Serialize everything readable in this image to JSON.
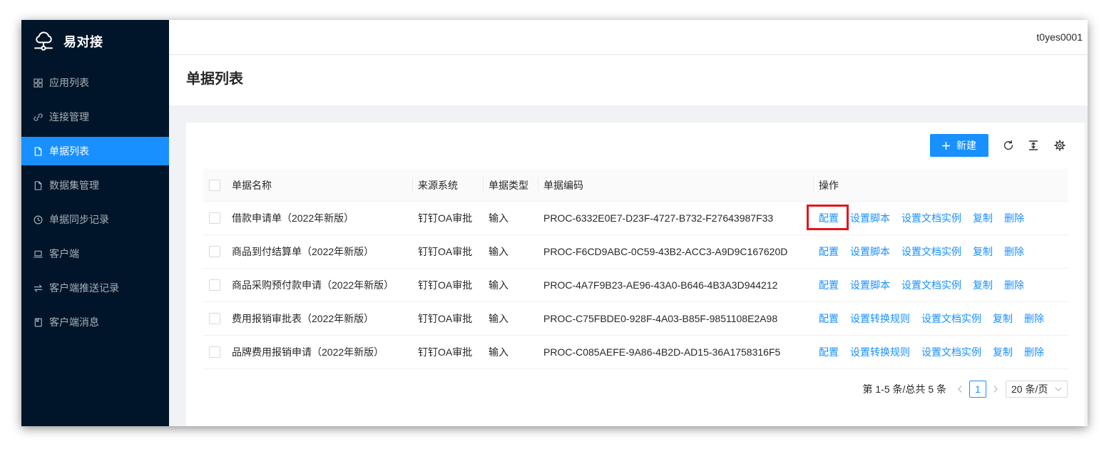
{
  "app": {
    "name": "易对接",
    "logo_icon": "cloud-logo-icon"
  },
  "sidebar": {
    "items": [
      {
        "label": "应用列表",
        "icon": "appstore-icon",
        "selected": false
      },
      {
        "label": "连接管理",
        "icon": "link-icon",
        "selected": false
      },
      {
        "label": "单据列表",
        "icon": "file-icon",
        "selected": true
      },
      {
        "label": "数据集管理",
        "icon": "file-icon",
        "selected": false
      },
      {
        "label": "单据同步记录",
        "icon": "clock-circle-icon",
        "selected": false
      },
      {
        "label": "客户端",
        "icon": "laptop-icon",
        "selected": false
      },
      {
        "label": "客户端推送记录",
        "icon": "swap-icon",
        "selected": false
      },
      {
        "label": "客户端消息",
        "icon": "book-icon",
        "selected": false
      }
    ]
  },
  "header": {
    "username": "t0yes0001"
  },
  "page": {
    "title": "单据列表"
  },
  "toolbar": {
    "new_button": {
      "label": "新建",
      "icon": "plus-icon"
    },
    "icons": [
      "reload-icon",
      "column-height-icon",
      "setting-icon"
    ]
  },
  "table": {
    "select_all_checked": false,
    "columns": [
      "单据名称",
      "来源系统",
      "单据类型",
      "单据编码",
      "操作"
    ],
    "rows": [
      {
        "checked": false,
        "name": "借款申请单（2022年新版）",
        "source": "钉钉OA审批",
        "type": "输入",
        "code": "PROC-6332E0E7-D23F-4727-B732-F27643987F33",
        "actions": [
          "配置",
          "设置脚本",
          "设置文档实例",
          "复制",
          "删除"
        ]
      },
      {
        "checked": false,
        "name": "商品到付结算单（2022年新版）",
        "source": "钉钉OA审批",
        "type": "输入",
        "code": "PROC-F6CD9ABC-0C59-43B2-ACC3-A9D9C167620D",
        "actions": [
          "配置",
          "设置脚本",
          "设置文档实例",
          "复制",
          "删除"
        ]
      },
      {
        "checked": false,
        "name": "商品采购预付款申请（2022年新版）",
        "source": "钉钉OA审批",
        "type": "输入",
        "code": "PROC-4A7F9B23-AE96-43A0-B646-4B3A3D944212",
        "actions": [
          "配置",
          "设置脚本",
          "设置文档实例",
          "复制",
          "删除"
        ]
      },
      {
        "checked": false,
        "name": "费用报销审批表（2022年新版）",
        "source": "钉钉OA审批",
        "type": "输入",
        "code": "PROC-C75FBDE0-928F-4A03-B85F-9851108E2A98",
        "actions": [
          "配置",
          "设置转换规则",
          "设置文档实例",
          "复制",
          "删除"
        ]
      },
      {
        "checked": false,
        "name": "品牌费用报销申请（2022年新版）",
        "source": "钉钉OA审批",
        "type": "输入",
        "code": "PROC-C085AEFE-9A86-4B2D-AD15-36A1758316F5",
        "actions": [
          "配置",
          "设置转换规则",
          "设置文档实例",
          "复制",
          "删除"
        ]
      }
    ]
  },
  "pagination": {
    "summary": "第 1-5 条/总共 5 条",
    "current_page": "1",
    "page_size": "20 条/页",
    "prev_icon": "left-icon",
    "next_icon": "right-icon",
    "page_size_icon": "down-icon"
  },
  "colors": {
    "sidebar_bg": "#001529",
    "primary": "#1890ff",
    "page_bg": "#f0f2f5",
    "highlight_box": "#e5131d"
  }
}
